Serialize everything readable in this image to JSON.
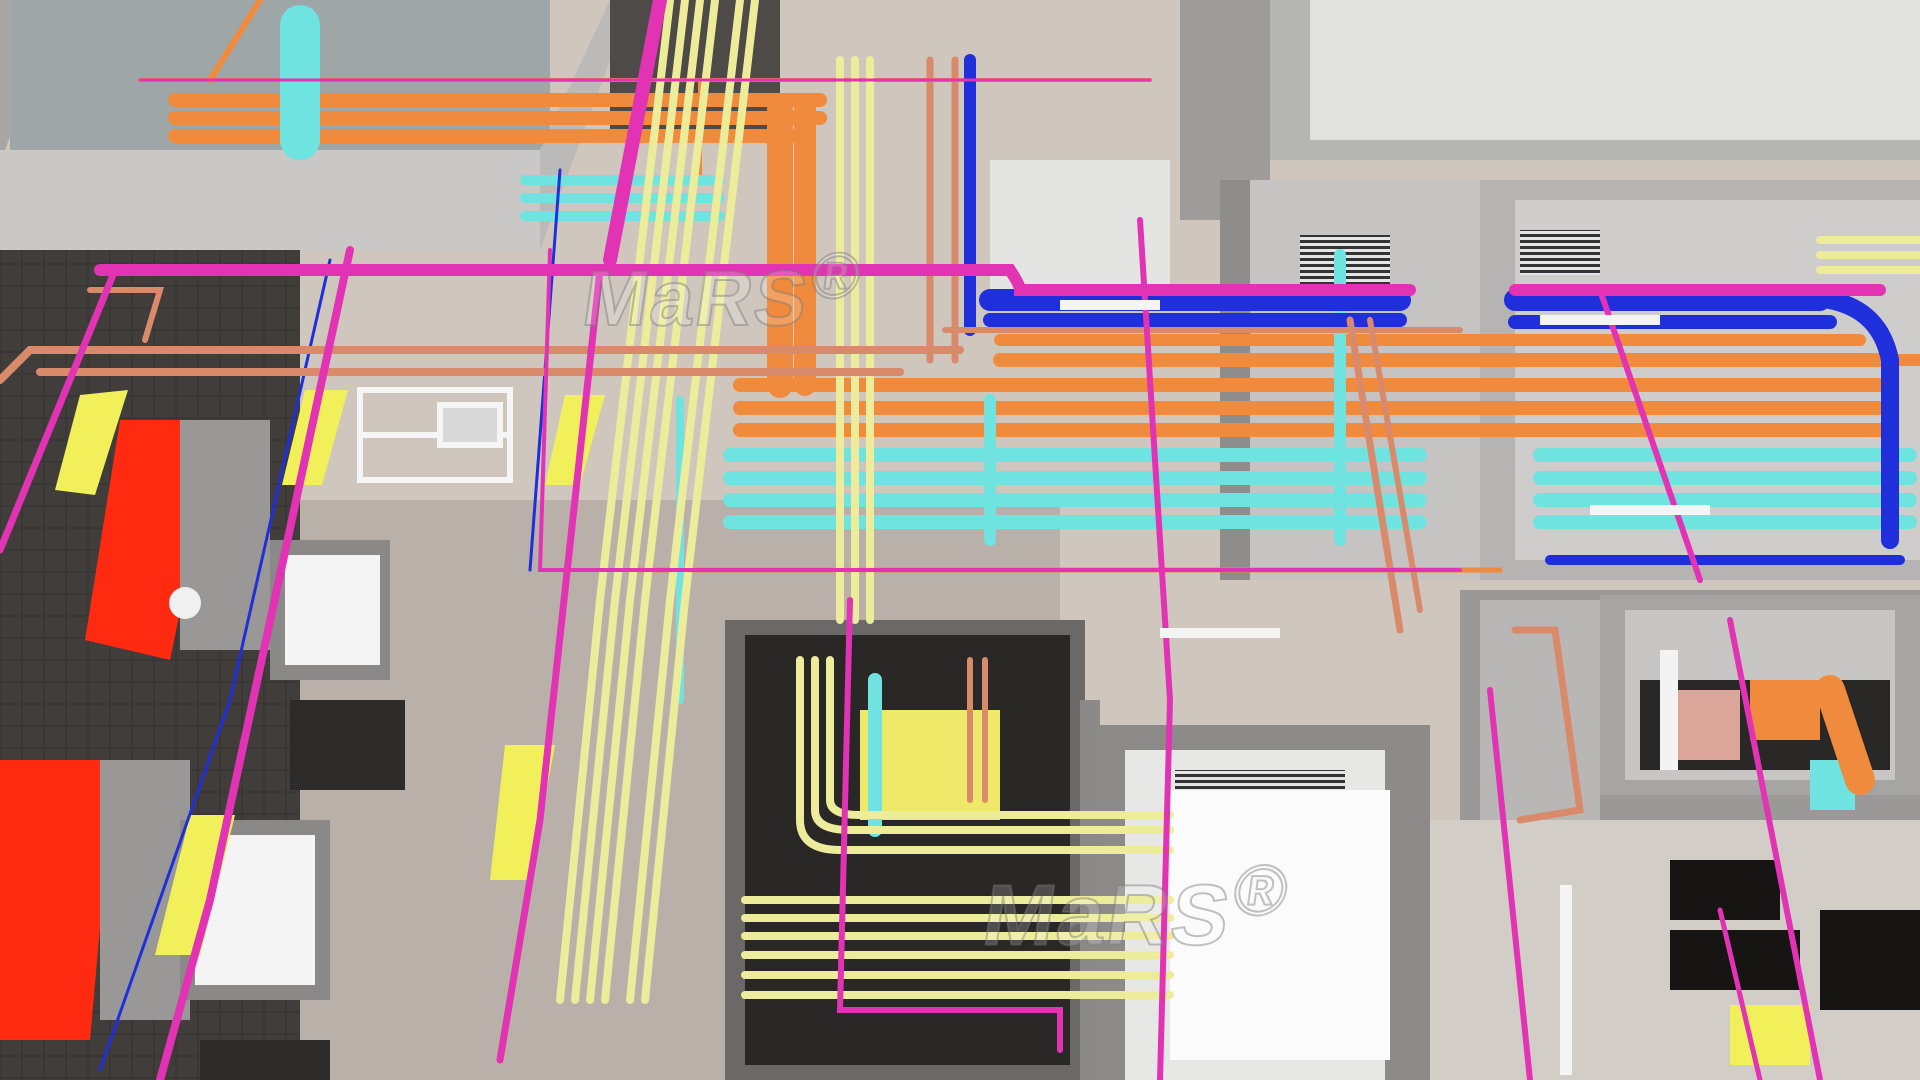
{
  "image": {
    "watermarks": [
      {
        "text": "MaRS",
        "mark": "®"
      },
      {
        "text": "MaRS",
        "mark": "®"
      }
    ]
  },
  "colors": {
    "hot_water_orange": "#f08a3c",
    "cold_water_cyan": "#6fe3df",
    "conduit_yellow": "#ecec9a",
    "magenta_pipe": "#e233b4",
    "blue_pipe": "#1f2fdc",
    "copper_pipe": "#d88a6a",
    "red_equipment": "#ff2a10",
    "yellow_panel": "#f2f05a",
    "wall_grey": "#cdccca",
    "floor": "#cfc5bd",
    "dark_shaft": "#2a2826"
  }
}
